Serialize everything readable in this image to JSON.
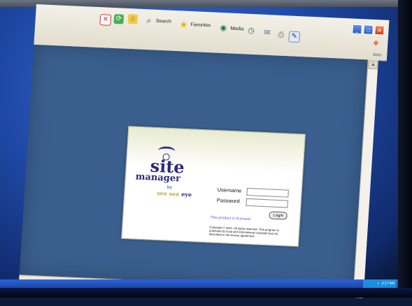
{
  "toolbar": {
    "search_label": "Search",
    "favorites_label": "Favorites",
    "media_label": "Media",
    "links_label": "links",
    "icons": [
      "stop-icon",
      "refresh-icon",
      "home-icon",
      "search-icon",
      "favorites-star-icon",
      "media-icon",
      "history-icon",
      "mail-icon",
      "print-icon",
      "edit-icon"
    ]
  },
  "login": {
    "logo_site": "site",
    "logo_manager": "manager",
    "logo_by": "by",
    "logo_see1": "see",
    "logo_see2": "see",
    "logo_eye": "eye",
    "username_label": "Username",
    "password_label": "Password",
    "login_button": "Login",
    "licensed_text": "This product is licensed.",
    "copyright_text": "Copyright © 2001. All rights reserved. This program is protected by local and international copyright laws as described in the license agreement."
  },
  "taskbar": {
    "clock": "3:17 AM"
  },
  "colors": {
    "content_bg": "#3a5f8f",
    "logo_color": "#2c2a7a",
    "accent_yellow": "#b7b03a",
    "link_color": "#5b5bd0"
  }
}
